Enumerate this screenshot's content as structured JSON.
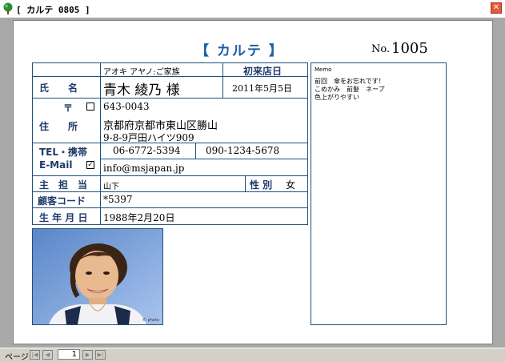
{
  "window": {
    "title": "[ カルテ  0805 ]",
    "close_glyph": "✕"
  },
  "header": {
    "title": "【 カルテ 】",
    "no_label": "No.",
    "no_value": "1005"
  },
  "card": {
    "furigana": "アオキ アヤノ:ご家族",
    "first_visit_label": "初来店日",
    "name_label": "氏　　名",
    "name_value": "青木 綾乃 様",
    "first_visit_value": "2011年5月5日",
    "postal_label": "〒",
    "postal_value": "643-0043",
    "address_label": "住　　所",
    "address_line1": "京都府京都市東山区勝山",
    "address_line2": "9-8-9戸田ハイツ909",
    "tel_label": "TEL・携帯",
    "tel_value": "06-6772-5394",
    "mobile_value": "090-1234-5678",
    "email_label": "E-Mail",
    "email_value": "info@msjapan.jp",
    "staff_label": "主　担　当",
    "staff_value": "山下",
    "gender_label": "性 別",
    "gender_value": "女",
    "customer_code_label": "顧客コード",
    "customer_code_value": "*5397",
    "birthday_label": "生 年 月 日",
    "birthday_value": "1988年2月20日",
    "email_checked": true,
    "postal_checked": false
  },
  "memo": {
    "label": "Memo",
    "text": "前回　傘をお忘れです！\nこめかみ　前髪　ネープ\n色上がりやすい"
  },
  "photo": {
    "credit": "© photo"
  },
  "statusbar": {
    "page_label": "ページ",
    "page_value": "1",
    "first": "|◀",
    "prev": "◀",
    "next": "▶",
    "last": "▶|"
  },
  "colors": {
    "accent": "#1a5fa8",
    "border": "#1f4f7a",
    "close": "#e5583a"
  }
}
